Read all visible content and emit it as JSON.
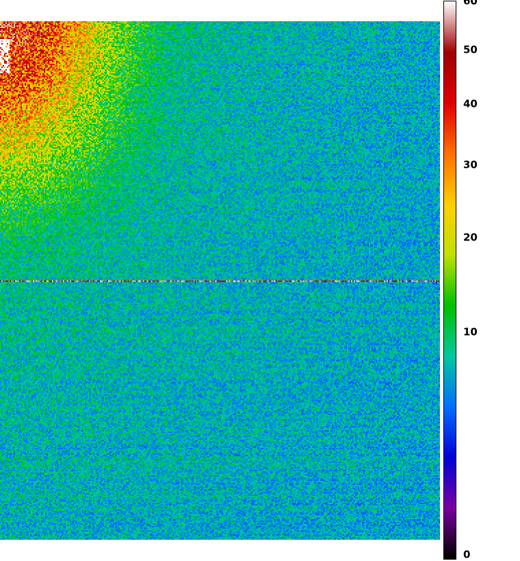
{
  "chart_data": {
    "type": "heatmap",
    "title": "",
    "xlabel": "",
    "ylabel": "",
    "colorbar": {
      "scale": "sqrt",
      "range": [
        0,
        60
      ],
      "ticks": [
        "60",
        "50",
        "40",
        "30",
        "20",
        "10",
        "0"
      ],
      "tick_values": [
        60,
        50,
        40,
        30,
        20,
        10,
        0
      ],
      "colormap": [
        "#000000",
        "#7a00a0",
        "#0000d8",
        "#0070ff",
        "#00c8a0",
        "#00c000",
        "#c0e000",
        "#ffd000",
        "#ff7000",
        "#e00000",
        "#a00000",
        "#ffffff"
      ]
    },
    "description_values": {
      "peak_region": "top-left",
      "peak_value": 60,
      "background_level": 6,
      "bright_row_fraction": 0.5
    }
  }
}
